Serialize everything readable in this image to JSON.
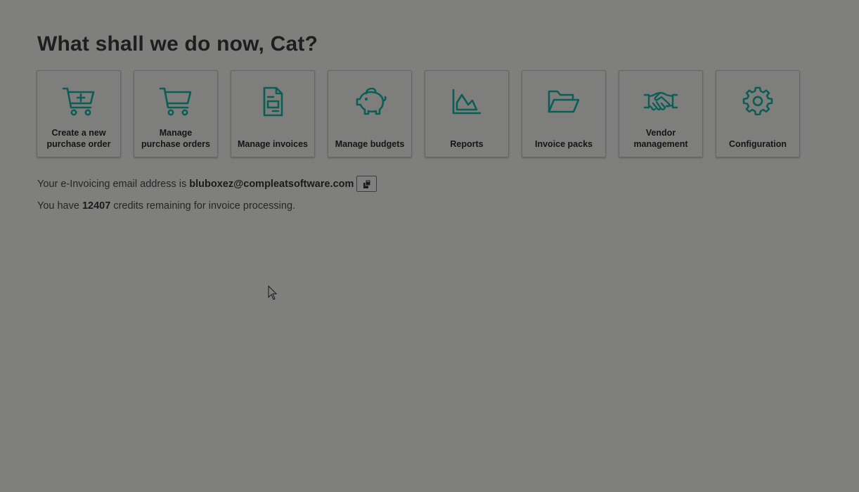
{
  "greeting": "What shall we do now, Cat?",
  "accent_color": "#0b5e55",
  "tiles": [
    {
      "label": "Create a new\npurchase order",
      "icon": "cart-plus-icon"
    },
    {
      "label": "Manage\npurchase orders",
      "icon": "cart-icon"
    },
    {
      "label": "Manage invoices",
      "icon": "invoice-document-icon"
    },
    {
      "label": "Manage budgets",
      "icon": "piggy-bank-icon"
    },
    {
      "label": "Reports",
      "icon": "area-chart-icon"
    },
    {
      "label": "Invoice packs",
      "icon": "folder-open-icon"
    },
    {
      "label": "Vendor\nmanagement",
      "icon": "handshake-icon"
    },
    {
      "label": "Configuration",
      "icon": "gear-icon"
    }
  ],
  "einvoicing": {
    "prefix": "Your e-Invoicing email address is",
    "email": "bluboxez@compleatsoftware.com",
    "copy_icon": "copy-clipboard-icon"
  },
  "credits": {
    "prefix": "You have",
    "count": "12407",
    "suffix": "credits remaining for invoice processing."
  }
}
